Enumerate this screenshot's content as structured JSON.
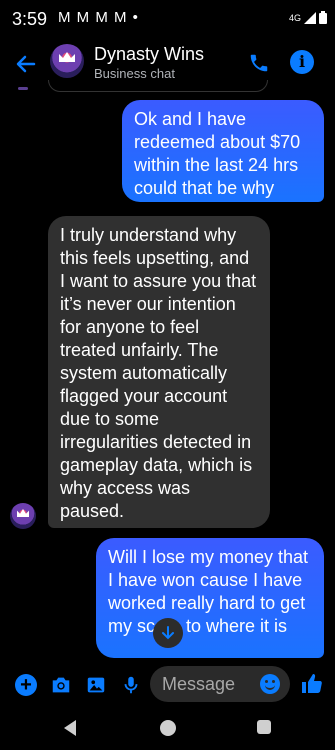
{
  "status_bar": {
    "time": "3:59",
    "notifications": "M M M M •",
    "network": "4G"
  },
  "header": {
    "contact_name": "Dynasty Wins",
    "subtitle": "Business chat",
    "back_icon": "arrow-left-icon",
    "call_icon": "phone-icon",
    "info_icon": "info-icon",
    "info_glyph": "i"
  },
  "messages": [
    {
      "direction": "outgoing",
      "text": "Ok and I have redeemed about $70 within the last 24 hrs could that be why"
    },
    {
      "direction": "incoming",
      "text": "I truly understand why this feels upsetting, and I want to assure you that it’s never our intention for anyone to feel treated unfairly. The system automatically flagged your account due to some irregularities detected in gameplay data, which is why access was paused."
    },
    {
      "direction": "outgoing",
      "text": "Will I lose my money that I have won cause I have worked really hard to get my score to where it is"
    }
  ],
  "composer": {
    "placeholder": "Message",
    "plus_glyph": "+",
    "icons": [
      "plus-icon",
      "camera-icon",
      "image-icon",
      "mic-icon",
      "emoji-icon",
      "thumbs-up-icon"
    ]
  },
  "colors": {
    "accent": "#0a7cff",
    "incoming_bubble": "#303030",
    "outgoing_bubble": "#1a73ff",
    "background": "#000000"
  }
}
